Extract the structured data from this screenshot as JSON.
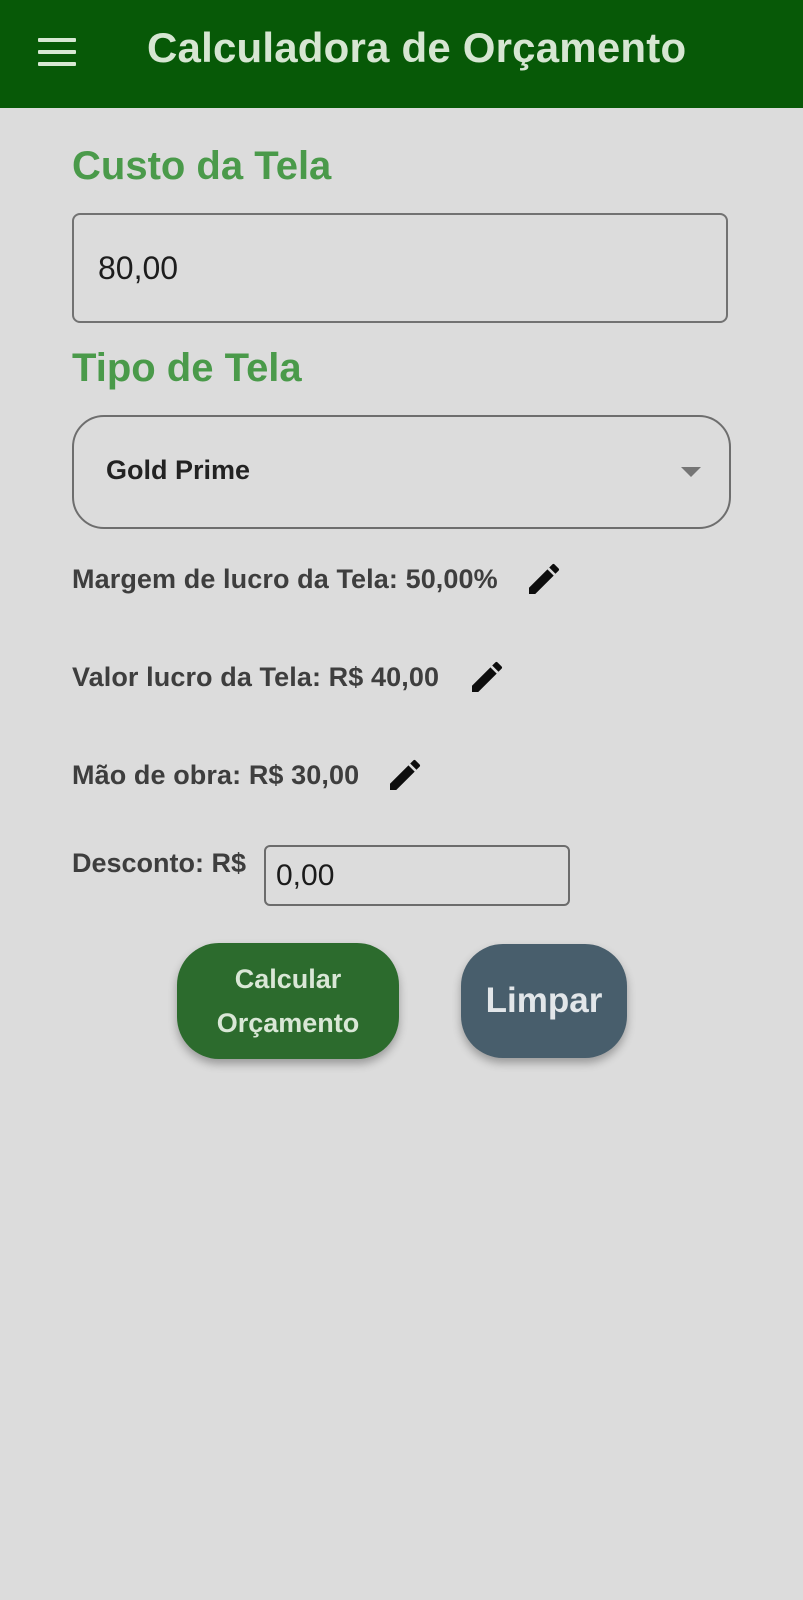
{
  "app_bar": {
    "title": "Calculadora de Orçamento",
    "menu_icon": "hamburger-menu-icon",
    "background": "#075907"
  },
  "screen_cost": {
    "section_title": "Custo da Tela",
    "value": "80,00"
  },
  "screen_type": {
    "section_title": "Tipo de Tela",
    "selected": "Gold Prime",
    "arrow_icon": "dropdown-arrow-icon"
  },
  "details": {
    "margin_label": "Margem de lucro da Tela: 50,00%",
    "profit_label": "Valor lucro da Tela: R$ 40,00",
    "labor_label": "Mão de obra: R$ 30,00",
    "edit_icon": "pencil-edit-icon"
  },
  "discount": {
    "label": "Desconto: R$",
    "value": "0,00"
  },
  "buttons": {
    "calculate_label": "Calcular Orçamento",
    "clear_label": "Limpar",
    "calculate_color": "#2c6b2d",
    "clear_color": "#485e6c"
  },
  "colors": {
    "accent_green": "#4a9a4a",
    "background": "#dcdcdc"
  }
}
